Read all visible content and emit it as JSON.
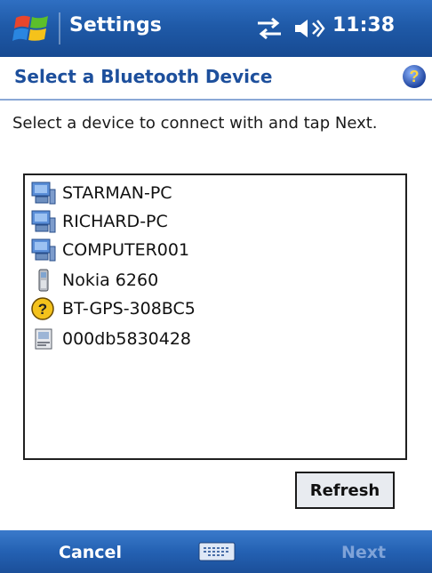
{
  "titlebar": {
    "title": "Settings",
    "time": "11:38",
    "icons": [
      "windows-start-icon",
      "connectivity-icon",
      "volume-icon"
    ]
  },
  "header": {
    "title": "Select a Bluetooth Device",
    "help_icon": "help-icon"
  },
  "instructions": "Select a device to connect with and tap Next.",
  "devices": [
    {
      "label": "STARMAN-PC",
      "icon": "computer-icon"
    },
    {
      "label": "RICHARD-PC",
      "icon": "computer-icon"
    },
    {
      "label": "COMPUTER001",
      "icon": "computer-icon"
    },
    {
      "label": "Nokia 6260",
      "icon": "phone-icon"
    },
    {
      "label": "BT-GPS-308BC5",
      "icon": "unknown-device-icon"
    },
    {
      "label": "000db5830428",
      "icon": "generic-device-icon"
    }
  ],
  "refresh_label": "Refresh",
  "menubar": {
    "left": "Cancel",
    "right": "Next",
    "center_icon": "keyboard-icon"
  },
  "colors": {
    "titlebar": "#1f5aa8",
    "header_text": "#1d4f9c",
    "menubar": "#2461b3",
    "disabled_softkey": "#7fa3d8"
  }
}
